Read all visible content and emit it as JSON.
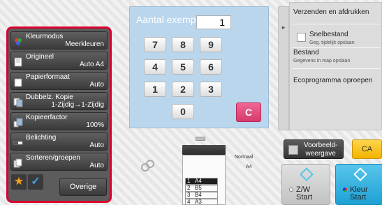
{
  "copies": {
    "label": "Aantal exempl.",
    "value": "1"
  },
  "keypad": {
    "keys": [
      "7",
      "8",
      "9",
      "4",
      "5",
      "6",
      "1",
      "2",
      "3",
      "0"
    ],
    "clear": "C"
  },
  "settings": [
    {
      "label": "Kleurmodus",
      "value": "Meerkleuren",
      "icon": "color-mode-icon"
    },
    {
      "label": "Origineel",
      "value": "Auto  A4",
      "icon": "original-icon"
    },
    {
      "label": "Papierformaat",
      "value": "Auto",
      "icon": "paper-size-icon"
    },
    {
      "label": "Dubbelz. Kopie",
      "value": "1-Zijdig→1-Zijdig",
      "icon": "duplex-icon"
    },
    {
      "label": "Kopieerfactor",
      "value": "100%",
      "icon": "zoom-icon"
    },
    {
      "label": "Belichting",
      "value": "Auto",
      "icon": "exposure-icon"
    },
    {
      "label": "Sorteren/groepen",
      "value": "Auto",
      "icon": "sort-icon"
    }
  ],
  "bottom": {
    "star": "★",
    "check": "✓",
    "other": "Overige"
  },
  "right_panel": {
    "tab_arrow": "▸",
    "title": "Verzenden en afdrukken",
    "snel_label": "Snelbestand",
    "snel_sub": "Geg. tijdelijk opslaan",
    "bestand_label": "Bestand",
    "bestand_sub": "Gegevens in map opslaan",
    "eco": "Ecoprogramma oproepen"
  },
  "machine": {
    "output": "Normaal",
    "tray_size": "A4",
    "trays": [
      {
        "n": "1",
        "size": "A4"
      },
      {
        "n": "2",
        "size": "B5"
      },
      {
        "n": "3",
        "size": "B4"
      },
      {
        "n": "4",
        "size": "A3"
      }
    ]
  },
  "actions": {
    "preview": "Voorbeeld-\nweergave",
    "ca": "CA",
    "bw_start": "Z/W\nStart",
    "color_start": "Kleur\nStart"
  },
  "colors": {
    "highlight": "#d9002f",
    "start": "#1ea1d4",
    "ca": "#f2b400",
    "clear": "#d63a6b"
  }
}
